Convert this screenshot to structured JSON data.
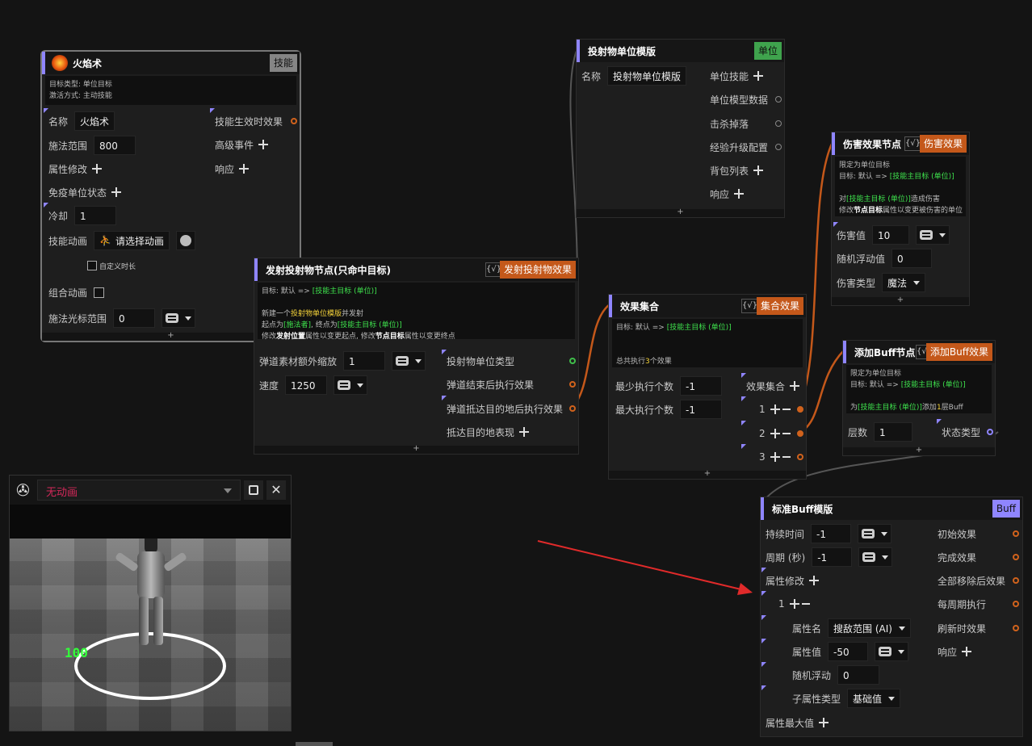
{
  "colors": {
    "accent": "#8f85ff",
    "wire": "#c4581a",
    "highlight_green": "#3ee24d",
    "highlight_yellow": "#f5d33a",
    "tag_orange": "#c4581a",
    "tag_green": "#3fa34d"
  },
  "fireball": {
    "title": "火焰术",
    "tag": "技能",
    "desc1": "目标类型: 单位目标",
    "desc2": "激活方式: 主动技能",
    "name_label": "名称",
    "name_value": "火焰术",
    "range_label": "施法范围",
    "range_value": "800",
    "attr_label": "属性修改",
    "immune_label": "免疫单位状态",
    "cd_label": "冷却",
    "cd_value": "1",
    "anim_label": "技能动画",
    "anim_value": "请选择动画",
    "custom_time": "自定义时长",
    "combo_label": "组合动画",
    "cursor_label": "施法光标范围",
    "cursor_value": "0",
    "out_effect": "技能生效时效果",
    "out_adv": "高级事件",
    "out_resp": "响应"
  },
  "launch": {
    "title": "发射投射物节点(只命中目标)",
    "check": "{√}",
    "tag": "发射投射物效果",
    "d_target": "目标: 默认 => ",
    "d_target_hl": "[技能主目标 (单位)]",
    "d_new_a": "新建一个",
    "d_new_hl": "投射物单位模版",
    "d_new_b": "并发射",
    "d_start_a": "起点为",
    "d_start_hl": "[施法者]",
    "d_start_b": ", 终点为",
    "d_start_hl2": "[技能主目标 (单位)]",
    "d_mod_a": "修改",
    "d_mod_b1": "发射位置",
    "d_mod_b": "属性以变更起点, 修改",
    "d_mod_b2": "节点目标",
    "d_mod_c": "属性以变更终点",
    "scale_label": "弹道素材额外缩放",
    "scale_value": "1",
    "speed_label": "速度",
    "speed_value": "1250",
    "out_type": "投射物单位类型",
    "out_end": "弹道结束后执行效果",
    "out_arrive": "弹道抵达目的地后执行效果",
    "out_perf": "抵达目的地表现"
  },
  "proj": {
    "title": "投射物单位模版",
    "tag": "单位",
    "name_label": "名称",
    "name_value": "投射物单位模版",
    "items": [
      "单位技能",
      "单位模型数据",
      "击杀掉落",
      "经验升级配置",
      "背包列表",
      "响应"
    ]
  },
  "set": {
    "title": "效果集合",
    "check": "{√}",
    "tag": "集合效果",
    "d_target": "目标: 默认 => ",
    "d_target_hl": "[技能主目标 (单位)]",
    "d_total_a": "总共执行",
    "d_total_hl": "3",
    "d_total_b": "个效果",
    "min_label": "最少执行个数",
    "min_value": "-1",
    "max_label": "最大执行个数",
    "max_value": "-1",
    "set_label": "效果集合",
    "idx": [
      "1",
      "2",
      "3"
    ]
  },
  "damage": {
    "title": "伤害效果节点",
    "check": "{√}",
    "tag": "伤害效果",
    "d1": "限定为单位目标",
    "d_target": "目标: 默认 => ",
    "d_target_hl": "[技能主目标 (单位)]",
    "d3_a": "对",
    "d3_hl": "[技能主目标 (单位)]",
    "d3_b": "造成伤害",
    "d4_a": "修改",
    "d4_b": "节点目标",
    "d4_c": "属性以变更被伤害的单位",
    "val_label": "伤害值",
    "val_value": "10",
    "rand_label": "随机浮动值",
    "rand_value": "0",
    "type_label": "伤害类型",
    "type_value": "魔法"
  },
  "buff": {
    "title": "添加Buff节点",
    "check": "{√}",
    "tag": "添加Buff效果",
    "d1": "限定为单位目标",
    "d_target": "目标: 默认 => ",
    "d_target_hl": "[技能主目标 (单位)]",
    "d3_a": "为",
    "d3_hl": "[技能主目标 (单位)]",
    "d3_b": "添加",
    "d3_n": "1",
    "d3_c": "层Buff",
    "layer_label": "层数",
    "layer_value": "1",
    "state_label": "状态类型"
  },
  "stdbuff": {
    "title": "标准Buff模版",
    "tag": "Buff",
    "dur_label": "持续时间",
    "dur_value": "-1",
    "period_label": "周期 (秒)",
    "period_value": "-1",
    "attr_label": "属性修改",
    "idx": "1",
    "aname_label": "属性名",
    "aname_value": "搜敌范围 (AI)",
    "aval_label": "属性值",
    "aval_value": "-50",
    "arand_label": "随机浮动",
    "arand_value": "0",
    "asub_label": "子属性类型",
    "asub_value": "基础值",
    "amax_label": "属性最大值",
    "outs": [
      "初始效果",
      "完成效果",
      "全部移除后效果",
      "每周期执行",
      "刷新时效果",
      "响应"
    ]
  },
  "preview": {
    "anim": "无动画",
    "hp": "100"
  }
}
